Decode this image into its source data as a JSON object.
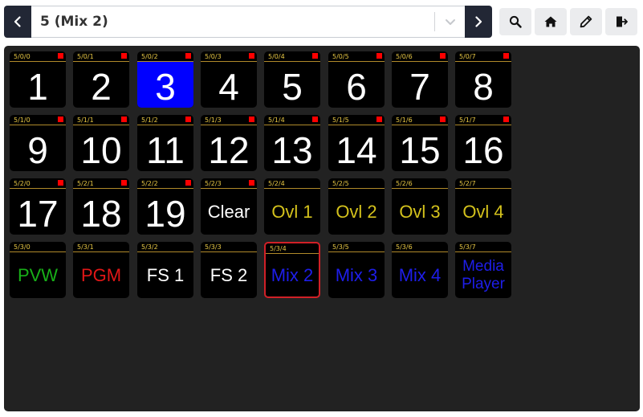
{
  "page_selector": {
    "value": "5 (Mix 2)"
  },
  "buttons": [
    {
      "addr": "5/0/0",
      "label": "1",
      "fg": "#ffffff",
      "bg": "#000000",
      "led": true,
      "size": "big"
    },
    {
      "addr": "5/0/1",
      "label": "2",
      "fg": "#ffffff",
      "bg": "#000000",
      "led": true,
      "size": "big"
    },
    {
      "addr": "5/0/2",
      "label": "3",
      "fg": "#ffffff",
      "bg": "#0000ff",
      "led": true,
      "size": "big"
    },
    {
      "addr": "5/0/3",
      "label": "4",
      "fg": "#ffffff",
      "bg": "#000000",
      "led": true,
      "size": "big"
    },
    {
      "addr": "5/0/4",
      "label": "5",
      "fg": "#ffffff",
      "bg": "#000000",
      "led": true,
      "size": "big"
    },
    {
      "addr": "5/0/5",
      "label": "6",
      "fg": "#ffffff",
      "bg": "#000000",
      "led": true,
      "size": "big"
    },
    {
      "addr": "5/0/6",
      "label": "7",
      "fg": "#ffffff",
      "bg": "#000000",
      "led": true,
      "size": "big"
    },
    {
      "addr": "5/0/7",
      "label": "8",
      "fg": "#ffffff",
      "bg": "#000000",
      "led": true,
      "size": "big"
    },
    {
      "addr": "5/1/0",
      "label": "9",
      "fg": "#ffffff",
      "bg": "#000000",
      "led": true,
      "size": "big"
    },
    {
      "addr": "5/1/1",
      "label": "10",
      "fg": "#ffffff",
      "bg": "#000000",
      "led": true,
      "size": "big"
    },
    {
      "addr": "5/1/2",
      "label": "11",
      "fg": "#ffffff",
      "bg": "#000000",
      "led": true,
      "size": "big"
    },
    {
      "addr": "5/1/3",
      "label": "12",
      "fg": "#ffffff",
      "bg": "#000000",
      "led": true,
      "size": "big"
    },
    {
      "addr": "5/1/4",
      "label": "13",
      "fg": "#ffffff",
      "bg": "#000000",
      "led": true,
      "size": "big"
    },
    {
      "addr": "5/1/5",
      "label": "14",
      "fg": "#ffffff",
      "bg": "#000000",
      "led": true,
      "size": "big"
    },
    {
      "addr": "5/1/6",
      "label": "15",
      "fg": "#ffffff",
      "bg": "#000000",
      "led": true,
      "size": "big"
    },
    {
      "addr": "5/1/7",
      "label": "16",
      "fg": "#ffffff",
      "bg": "#000000",
      "led": true,
      "size": "big"
    },
    {
      "addr": "5/2/0",
      "label": "17",
      "fg": "#ffffff",
      "bg": "#000000",
      "led": true,
      "size": "big"
    },
    {
      "addr": "5/2/1",
      "label": "18",
      "fg": "#ffffff",
      "bg": "#000000",
      "led": true,
      "size": "big"
    },
    {
      "addr": "5/2/2",
      "label": "19",
      "fg": "#ffffff",
      "bg": "#000000",
      "led": true,
      "size": "big"
    },
    {
      "addr": "5/2/3",
      "label": "Clear",
      "fg": "#ffffff",
      "bg": "#000000",
      "led": true,
      "size": "small"
    },
    {
      "addr": "5/2/4",
      "label": "Ovl 1",
      "fg": "#d4c21c",
      "bg": "#000000",
      "led": false,
      "size": "small"
    },
    {
      "addr": "5/2/5",
      "label": "Ovl 2",
      "fg": "#d4c21c",
      "bg": "#000000",
      "led": false,
      "size": "small"
    },
    {
      "addr": "5/2/6",
      "label": "Ovl 3",
      "fg": "#d4c21c",
      "bg": "#000000",
      "led": false,
      "size": "small"
    },
    {
      "addr": "5/2/7",
      "label": "Ovl 4",
      "fg": "#d4c21c",
      "bg": "#000000",
      "led": false,
      "size": "small"
    },
    {
      "addr": "5/3/0",
      "label": "PVW",
      "fg": "#18b018",
      "bg": "#000000",
      "led": false,
      "size": "small"
    },
    {
      "addr": "5/3/1",
      "label": "PGM",
      "fg": "#e21717",
      "bg": "#000000",
      "led": false,
      "size": "small"
    },
    {
      "addr": "5/3/2",
      "label": "FS 1",
      "fg": "#ffffff",
      "bg": "#000000",
      "led": false,
      "size": "small"
    },
    {
      "addr": "5/3/3",
      "label": "FS 2",
      "fg": "#ffffff",
      "bg": "#000000",
      "led": false,
      "size": "small"
    },
    {
      "addr": "5/3/4",
      "label": "Mix 2",
      "fg": "#1e1eea",
      "bg": "#000000",
      "led": false,
      "size": "small",
      "selected": true
    },
    {
      "addr": "5/3/5",
      "label": "Mix 3",
      "fg": "#1e1eea",
      "bg": "#000000",
      "led": false,
      "size": "small"
    },
    {
      "addr": "5/3/6",
      "label": "Mix 4",
      "fg": "#1e1eea",
      "bg": "#000000",
      "led": false,
      "size": "small"
    },
    {
      "addr": "5/3/7",
      "label": "Media\nPlayer",
      "fg": "#1e1eea",
      "bg": "#000000",
      "led": false,
      "size": "tiny"
    }
  ],
  "colors": {
    "toolbar_dark": "#222735",
    "grid_bg": "#222222",
    "led_red": "#ff0000",
    "addr_yellow": "#e7c744",
    "selected_border": "#d12027"
  }
}
